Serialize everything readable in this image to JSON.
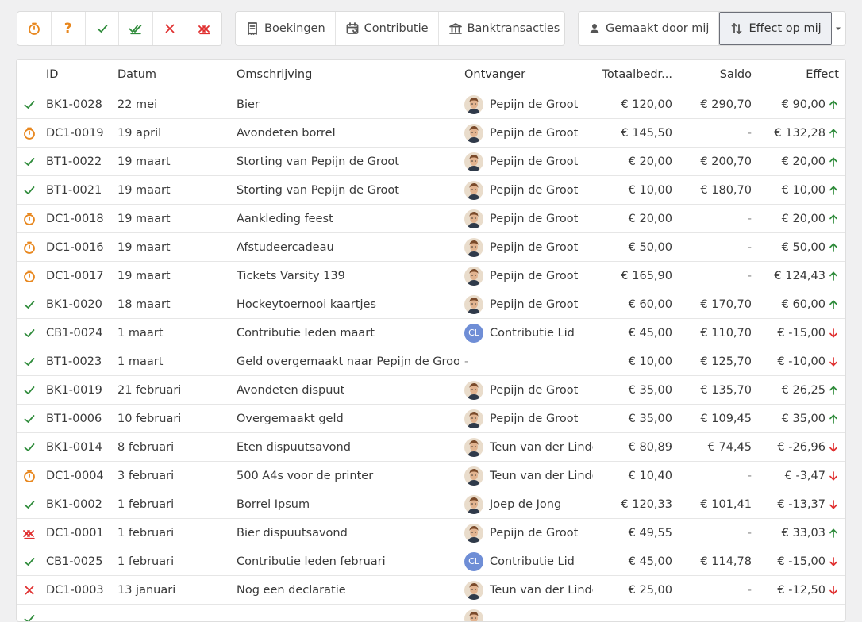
{
  "toolbar": {
    "status_filters": [
      {
        "icon": "timer-icon",
        "label": ""
      },
      {
        "icon": "question-icon",
        "label": "?"
      },
      {
        "icon": "check-icon",
        "label": ""
      },
      {
        "icon": "double-check-icon",
        "label": ""
      },
      {
        "icon": "cross-icon",
        "label": ""
      },
      {
        "icon": "double-cross-icon",
        "label": ""
      }
    ],
    "type_filters": [
      {
        "icon": "receipt-icon",
        "label": "Boekingen"
      },
      {
        "icon": "calendar-icon",
        "label": "Contributie"
      },
      {
        "icon": "bank-icon",
        "label": "Banktransacties"
      }
    ],
    "view_filters": [
      {
        "icon": "person-icon",
        "label": "Gemaakt door mij"
      },
      {
        "icon": "swap-vertical-icon",
        "label": "Effect op mij"
      }
    ]
  },
  "table": {
    "headers": {
      "id": "ID",
      "datum": "Datum",
      "omschrijving": "Omschrijving",
      "ontvanger": "Ontvanger",
      "totaal": "Totaalbedr...",
      "saldo": "Saldo",
      "effect": "Effect"
    },
    "rows": [
      {
        "status": "check",
        "id": "BK1-0028",
        "datum": "22 mei",
        "omschrijving": "Bier",
        "ontvanger": "Pepijn de Groot",
        "avatar": "photo",
        "totaal": "€ 120,00",
        "saldo": "€ 290,70",
        "effect": "€ 90,00",
        "dir": "up"
      },
      {
        "status": "timer",
        "id": "DC1-0019",
        "datum": "19 april",
        "omschrijving": "Avondeten borrel",
        "ontvanger": "Pepijn de Groot",
        "avatar": "photo",
        "totaal": "€ 145,50",
        "saldo": "-",
        "effect": "€ 132,28",
        "dir": "up"
      },
      {
        "status": "check",
        "id": "BT1-0022",
        "datum": "19 maart",
        "omschrijving": "Storting van Pepijn de Groot",
        "ontvanger": "Pepijn de Groot",
        "avatar": "photo",
        "totaal": "€ 20,00",
        "saldo": "€ 200,70",
        "effect": "€ 20,00",
        "dir": "up"
      },
      {
        "status": "check",
        "id": "BT1-0021",
        "datum": "19 maart",
        "omschrijving": "Storting van Pepijn de Groot",
        "ontvanger": "Pepijn de Groot",
        "avatar": "photo",
        "totaal": "€ 10,00",
        "saldo": "€ 180,70",
        "effect": "€ 10,00",
        "dir": "up"
      },
      {
        "status": "timer",
        "id": "DC1-0018",
        "datum": "19 maart",
        "omschrijving": "Aankleding feest",
        "ontvanger": "Pepijn de Groot",
        "avatar": "photo",
        "totaal": "€ 20,00",
        "saldo": "-",
        "effect": "€ 20,00",
        "dir": "up"
      },
      {
        "status": "timer",
        "id": "DC1-0016",
        "datum": "19 maart",
        "omschrijving": "Afstudeercadeau",
        "ontvanger": "Pepijn de Groot",
        "avatar": "photo",
        "totaal": "€ 50,00",
        "saldo": "-",
        "effect": "€ 50,00",
        "dir": "up"
      },
      {
        "status": "timer",
        "id": "DC1-0017",
        "datum": "19 maart",
        "omschrijving": "Tickets Varsity 139",
        "ontvanger": "Pepijn de Groot",
        "avatar": "photo",
        "totaal": "€ 165,90",
        "saldo": "-",
        "effect": "€ 124,43",
        "dir": "up"
      },
      {
        "status": "check",
        "id": "BK1-0020",
        "datum": "18 maart",
        "omschrijving": "Hockeytoernooi kaartjes",
        "ontvanger": "Pepijn de Groot",
        "avatar": "photo",
        "totaal": "€ 60,00",
        "saldo": "€ 170,70",
        "effect": "€ 60,00",
        "dir": "up"
      },
      {
        "status": "check",
        "id": "CB1-0024",
        "datum": "1 maart",
        "omschrijving": "Contributie leden maart",
        "ontvanger": "Contributie Lid",
        "avatar": "CL",
        "totaal": "€ 45,00",
        "saldo": "€ 110,70",
        "effect": "€ -15,00",
        "dir": "down"
      },
      {
        "status": "check",
        "id": "BT1-0023",
        "datum": "1 maart",
        "omschrijving": "Geld overgemaakt naar Pepijn de Groot",
        "ontvanger": "-",
        "avatar": "none",
        "totaal": "€ 10,00",
        "saldo": "€ 125,70",
        "effect": "€ -10,00",
        "dir": "down"
      },
      {
        "status": "check",
        "id": "BK1-0019",
        "datum": "21 februari",
        "omschrijving": "Avondeten dispuut",
        "ontvanger": "Pepijn de Groot",
        "avatar": "photo",
        "totaal": "€ 35,00",
        "saldo": "€ 135,70",
        "effect": "€ 26,25",
        "dir": "up"
      },
      {
        "status": "check",
        "id": "BT1-0006",
        "datum": "10 februari",
        "omschrijving": "Overgemaakt geld",
        "ontvanger": "Pepijn de Groot",
        "avatar": "photo",
        "totaal": "€ 35,00",
        "saldo": "€ 109,45",
        "effect": "€ 35,00",
        "dir": "up"
      },
      {
        "status": "check",
        "id": "BK1-0014",
        "datum": "8 februari",
        "omschrijving": "Eten dispuutsavond",
        "ontvanger": "Teun van der Linde",
        "avatar": "photo",
        "totaal": "€ 80,89",
        "saldo": "€ 74,45",
        "effect": "€ -26,96",
        "dir": "down"
      },
      {
        "status": "timer",
        "id": "DC1-0004",
        "datum": "3 februari",
        "omschrijving": "500 A4s voor de printer",
        "ontvanger": "Teun van der Linde",
        "avatar": "photo",
        "totaal": "€ 10,40",
        "saldo": "-",
        "effect": "€ -3,47",
        "dir": "down"
      },
      {
        "status": "check",
        "id": "BK1-0002",
        "datum": "1 februari",
        "omschrijving": "Borrel Ipsum",
        "ontvanger": "Joep de Jong",
        "avatar": "photo",
        "totaal": "€ 120,33",
        "saldo": "€ 101,41",
        "effect": "€ -13,37",
        "dir": "down"
      },
      {
        "status": "double-cross",
        "id": "DC1-0001",
        "datum": "1 februari",
        "omschrijving": "Bier dispuutsavond",
        "ontvanger": "Pepijn de Groot",
        "avatar": "photo",
        "totaal": "€ 49,55",
        "saldo": "-",
        "effect": "€ 33,03",
        "dir": "up"
      },
      {
        "status": "check",
        "id": "CB1-0025",
        "datum": "1 februari",
        "omschrijving": "Contributie leden februari",
        "ontvanger": "Contributie Lid",
        "avatar": "CL",
        "totaal": "€ 45,00",
        "saldo": "€ 114,78",
        "effect": "€ -15,00",
        "dir": "down"
      },
      {
        "status": "cross",
        "id": "DC1-0003",
        "datum": "13 januari",
        "omschrijving": "Nog een declaratie",
        "ontvanger": "Teun van der Linde",
        "avatar": "photo",
        "totaal": "€ 25,00",
        "saldo": "-",
        "effect": "€ -12,50",
        "dir": "down"
      },
      {
        "status": "check",
        "id": "",
        "datum": "",
        "omschrijving": "",
        "ontvanger": "",
        "avatar": "photo",
        "totaal": "",
        "saldo": "",
        "effect": "",
        "dir": "none"
      }
    ]
  },
  "colors": {
    "orange": "#e8871e",
    "green": "#2e8b3a",
    "red": "#e03030",
    "up_arrow": "#2e8b3a",
    "down_arrow": "#e03030"
  }
}
